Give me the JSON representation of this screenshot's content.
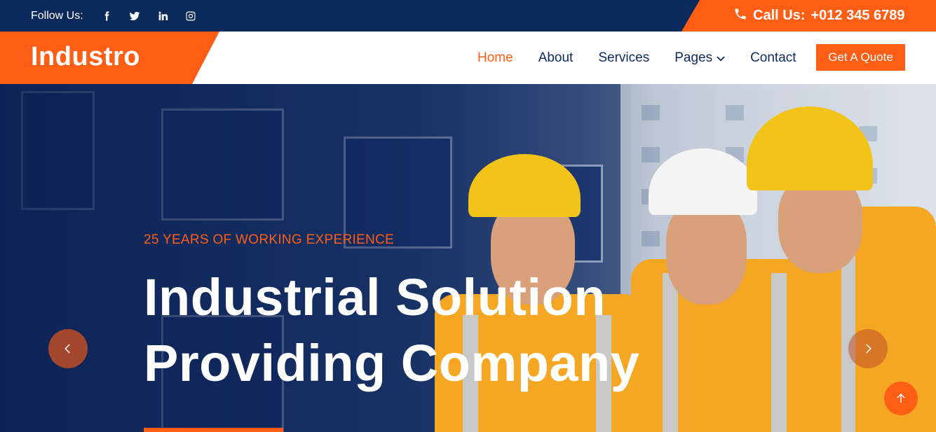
{
  "topbar": {
    "follow_label": "Follow Us:",
    "socials": [
      "facebook-icon",
      "twitter-icon",
      "linkedin-icon",
      "instagram-icon"
    ],
    "call_label": "Call Us:",
    "phone": "+012 345 6789"
  },
  "brand": {
    "name": "Industro"
  },
  "nav": {
    "items": [
      {
        "label": "Home",
        "active": true
      },
      {
        "label": "About",
        "active": false
      },
      {
        "label": "Services",
        "active": false
      },
      {
        "label": "Pages",
        "active": false
      },
      {
        "label": "Contact",
        "active": false
      }
    ],
    "quote_label": "Get A Quote"
  },
  "hero": {
    "subtitle": "25 YEARS OF WORKING EXPERIENCE",
    "title_line1": "Industrial Solution",
    "title_line2": "Providing Company"
  },
  "colors": {
    "accent": "#ff5e14",
    "navy": "#0b2a5b"
  }
}
